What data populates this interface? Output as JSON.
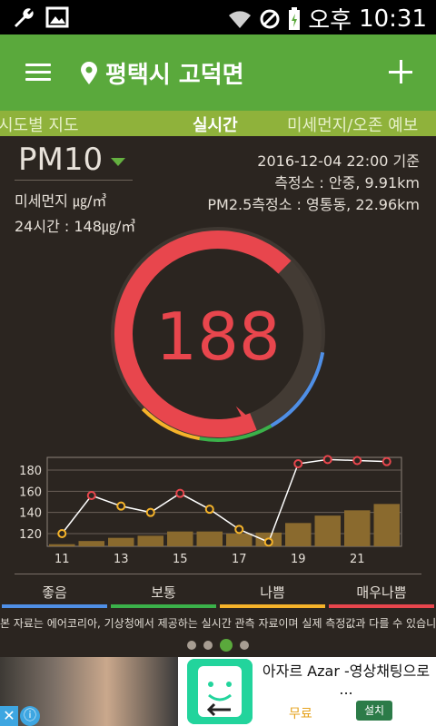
{
  "status_bar": {
    "time_label": "오후",
    "time": "10:31"
  },
  "app_bar": {
    "title": "평택시 고덕면"
  },
  "tabs": [
    {
      "label": "시도별 지도"
    },
    {
      "label": "실시간"
    },
    {
      "label": "미세먼지/오존 예보"
    }
  ],
  "pollutant": {
    "name": "PM10"
  },
  "info": {
    "unit_label": "미세먼지  ㎍/㎥",
    "avg_24h": "24시간 :  148㎍/㎥",
    "datetime": "2016-12-04   22:00 기준",
    "station": "측정소 : 안중, 9.91km",
    "pm25_station": "PM2.5측정소 : 영통동, 22.96km"
  },
  "gauge": {
    "value": "188",
    "level": 188,
    "max": 250
  },
  "chart_data": {
    "type": "bar",
    "x": [
      11,
      12,
      13,
      14,
      15,
      16,
      17,
      18,
      19,
      20,
      21,
      22
    ],
    "tick_labels": [
      "11",
      "13",
      "15",
      "17",
      "19",
      "21"
    ],
    "y_ticks": [
      120,
      140,
      160,
      180
    ],
    "ylim": [
      108,
      192
    ],
    "bars": [
      110,
      113,
      116,
      118,
      122,
      122,
      120,
      121,
      130,
      137,
      142,
      148
    ],
    "series": [
      {
        "values": [
          120,
          156,
          146,
          140,
          158,
          143,
          124,
          112,
          186,
          190,
          189,
          188
        ]
      }
    ],
    "point_colors": [
      "#f5b32a",
      "#e8464d",
      "#f5b32a",
      "#f5b32a",
      "#e8464d",
      "#f5b32a",
      "#f5b32a",
      "#f5b32a",
      "#e8464d",
      "#e8464d",
      "#e8464d",
      "#e8464d"
    ],
    "grid": true
  },
  "legend": [
    {
      "label": "좋음",
      "color": "#4f8fe6"
    },
    {
      "label": "보통",
      "color": "#3bb14a"
    },
    {
      "label": "나쁨",
      "color": "#f5b32a"
    },
    {
      "label": "매우나쁨",
      "color": "#e8464d"
    }
  ],
  "note": "본 자료는 에어코리아, 기상청에서 제공하는 실시간 관측 자료이며 실제 측정값과 다를 수 있습니다",
  "pager": {
    "count": 4,
    "active": 2
  },
  "ad": {
    "title": "아자르 Azar -영상채팅으로 ...",
    "price": "무료",
    "install": "설치",
    "close": "✕",
    "info": "ⓘ"
  },
  "colors": {
    "app_green": "#5aa93c",
    "tab_green": "#8fb23b",
    "gauge_red": "#e8464d",
    "background": "#2b2520"
  }
}
